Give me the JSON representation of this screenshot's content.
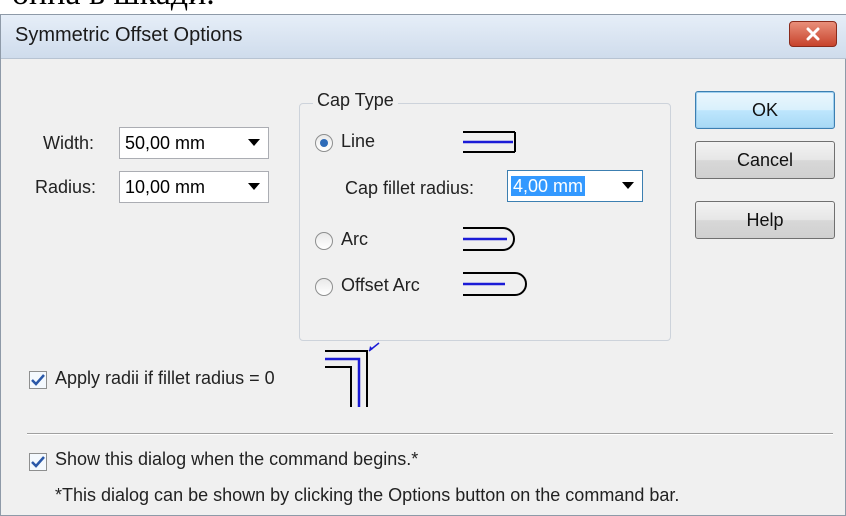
{
  "fragment": {
    "text": "онна в шкади."
  },
  "window": {
    "title": "Symmetric Offset Options",
    "close_icon": "close-icon"
  },
  "fields": {
    "width_label": "Width:",
    "width_value": "50,00 mm",
    "radius_label": "Radius:",
    "radius_value": "10,00 mm"
  },
  "cap_type": {
    "group_label": "Cap Type",
    "options": [
      {
        "label": "Line",
        "selected": true
      },
      {
        "label": "Arc",
        "selected": false
      },
      {
        "label": "Offset Arc",
        "selected": false
      }
    ],
    "fillet_label": "Cap fillet radius:",
    "fillet_value": "4,00 mm"
  },
  "buttons": {
    "ok": "OK",
    "cancel": "Cancel",
    "help": "Help"
  },
  "apply_radii": {
    "label": "Apply radii if fillet radius = 0",
    "checked": true
  },
  "show_dialog": {
    "label": "Show this dialog when the command begins.*",
    "checked": true
  },
  "note": "*This dialog can be shown by clicking the Options button on the command bar.",
  "colors": {
    "accent_blue": "#1b1bd6",
    "selection": "#3399ff"
  }
}
